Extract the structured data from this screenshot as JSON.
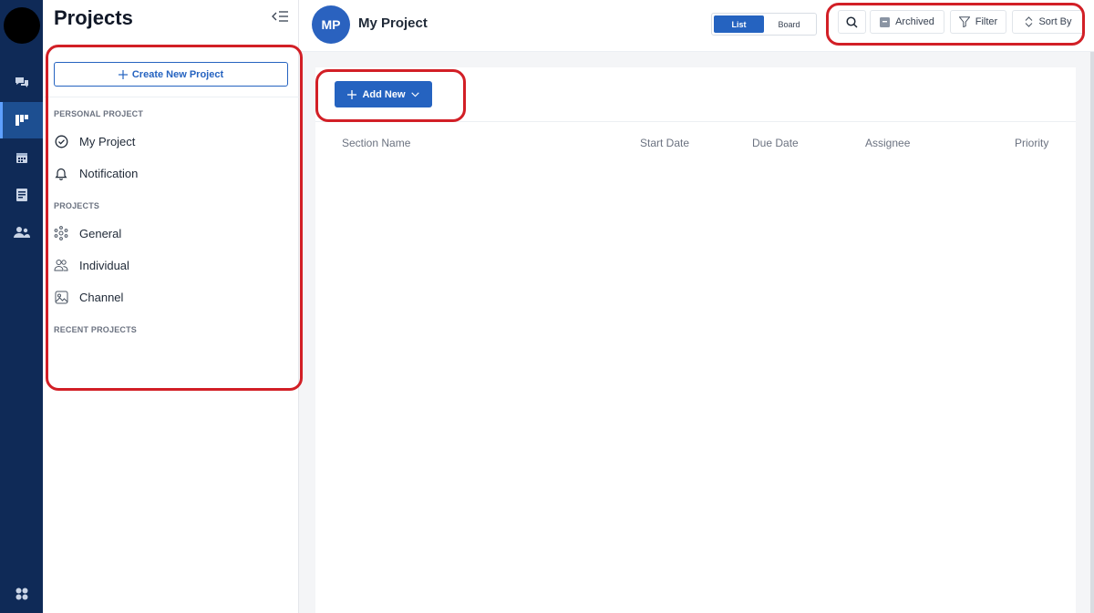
{
  "sidebar": {
    "title": "Projects",
    "create_button": "Create New Project",
    "sections": {
      "personal": "PERSONAL PROJECT",
      "projects": "PROJECTS",
      "recent": "RECENT PROJECTS"
    },
    "personal_items": [
      {
        "label": "My Project",
        "icon": "check-circle-icon"
      },
      {
        "label": "Notification",
        "icon": "bell-icon"
      }
    ],
    "project_items": [
      {
        "label": "General",
        "icon": "network-icon"
      },
      {
        "label": "Individual",
        "icon": "users-icon"
      },
      {
        "label": "Channel",
        "icon": "channel-icon"
      }
    ]
  },
  "rail": {
    "items": [
      "chat-icon",
      "board-icon",
      "calendar-icon",
      "notes-icon",
      "team-icon",
      "apps-icon"
    ],
    "active": "board-icon"
  },
  "header": {
    "avatar_initials": "MP",
    "project_name": "My Project",
    "view_toggle": {
      "list": "List",
      "board": "Board",
      "selected": "List"
    },
    "archived": "Archived",
    "filter": "Filter",
    "sort_by": "Sort By"
  },
  "main": {
    "add_new": "Add New",
    "columns": [
      "Section Name",
      "Start Date",
      "Due Date",
      "Assignee",
      "Priority"
    ]
  },
  "colors": {
    "rail": "#0f2a57",
    "primary": "#2563c0",
    "highlight": "#d21f26"
  }
}
